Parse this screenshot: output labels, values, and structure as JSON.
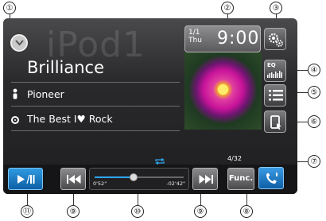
{
  "screen": {
    "watermark": "iPod1",
    "song_title": "Brilliance",
    "artist": "Pioneer",
    "album": "The Best I♥ Rock",
    "date_line1": "1/1",
    "date_line2": "Thu",
    "time": "9:00",
    "eq_label": "EQ",
    "track_counter": "4/32",
    "func_label": "Func.",
    "elapsed_time": "0'52\"",
    "remaining_time": "-02'42\"",
    "progress_fraction": 0.44
  },
  "callouts": [
    "①",
    "②",
    "③",
    "④",
    "⑤",
    "⑥",
    "⑦",
    "⑧",
    "⑨",
    "⑩",
    "⑪",
    "⑨"
  ],
  "colors": {
    "accent_blue": "#1d7fd0",
    "panel_dark": "#1e1e20"
  },
  "icons": [
    "chevron-down-icon",
    "settings-gears-icon",
    "eq-icon",
    "list-icon",
    "device-icon",
    "play-pause-icon",
    "previous-track-icon",
    "next-track-icon",
    "phone-icon",
    "repeat-icon",
    "person-icon",
    "disc-icon"
  ]
}
